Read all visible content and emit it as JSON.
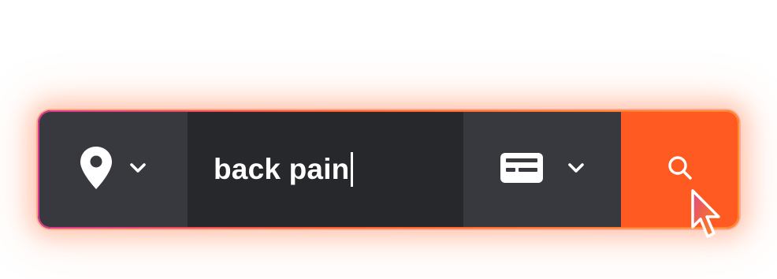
{
  "search_bar": {
    "location_selector": {
      "icon": "map-pin-icon",
      "dropdown_icon": "chevron-down-icon"
    },
    "query": {
      "value": "back pain"
    },
    "category_selector": {
      "icon": "id-card-icon",
      "dropdown_icon": "chevron-down-icon"
    },
    "search_button": {
      "icon": "search-icon"
    }
  },
  "colors": {
    "accent": "#ff5a22",
    "segment_dark": "#37393e",
    "input_bg": "#26282b",
    "glow": "#ff5f28"
  },
  "cursor": {
    "icon": "mouse-pointer-icon"
  }
}
